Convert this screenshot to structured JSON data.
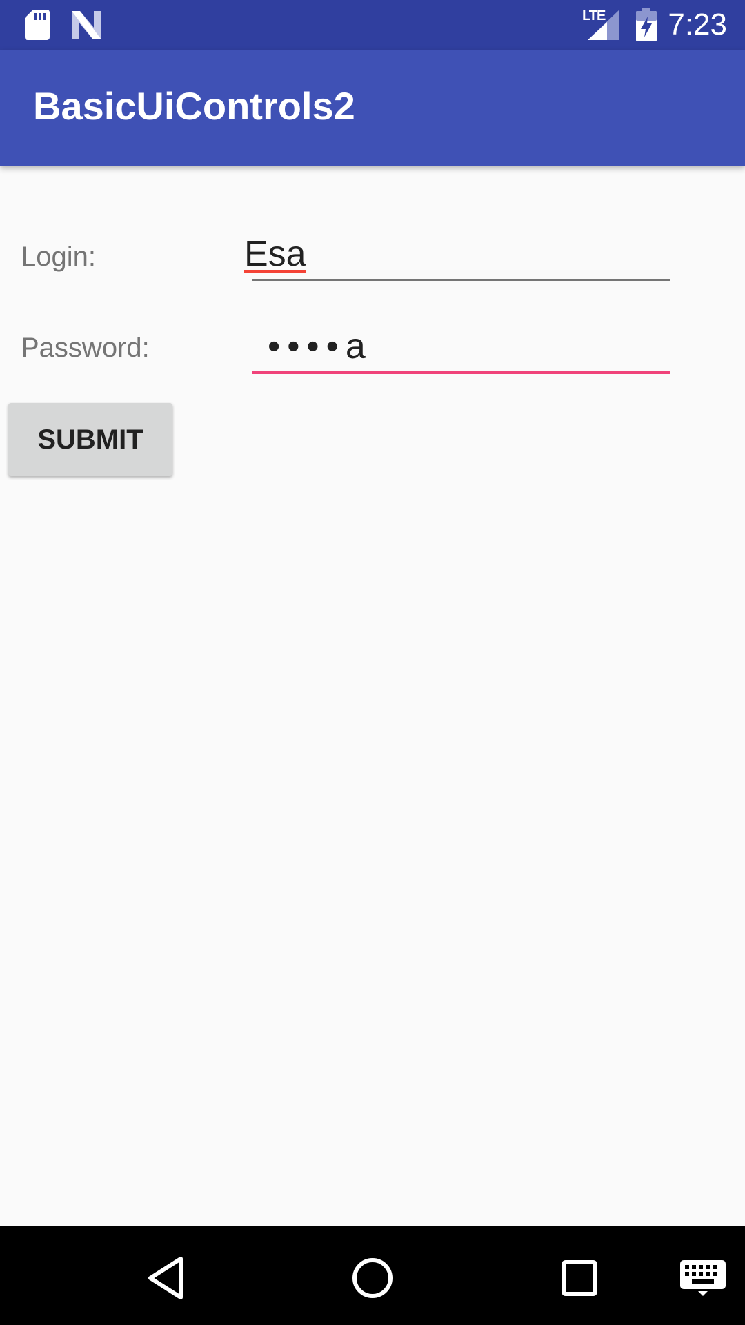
{
  "status_bar": {
    "network_type": "LTE",
    "time": "7:23",
    "icons": [
      "sd-card-icon",
      "n-logo-icon",
      "signal-icon",
      "battery-charging-icon"
    ]
  },
  "app_bar": {
    "title": "BasicUiControls2"
  },
  "form": {
    "login_label": "Login:",
    "login_value": "Esa",
    "password_label": "Password:",
    "password_value": "••••a",
    "submit_label": "SUBMIT"
  },
  "nav_bar": {
    "icons": [
      "back-icon",
      "home-icon",
      "recents-icon",
      "keyboard-icon"
    ]
  },
  "colors": {
    "status_bar": "#303f9f",
    "app_bar": "#3f51b5",
    "accent": "#f0437a",
    "background": "#fafafa",
    "button": "#d6d7d7"
  }
}
